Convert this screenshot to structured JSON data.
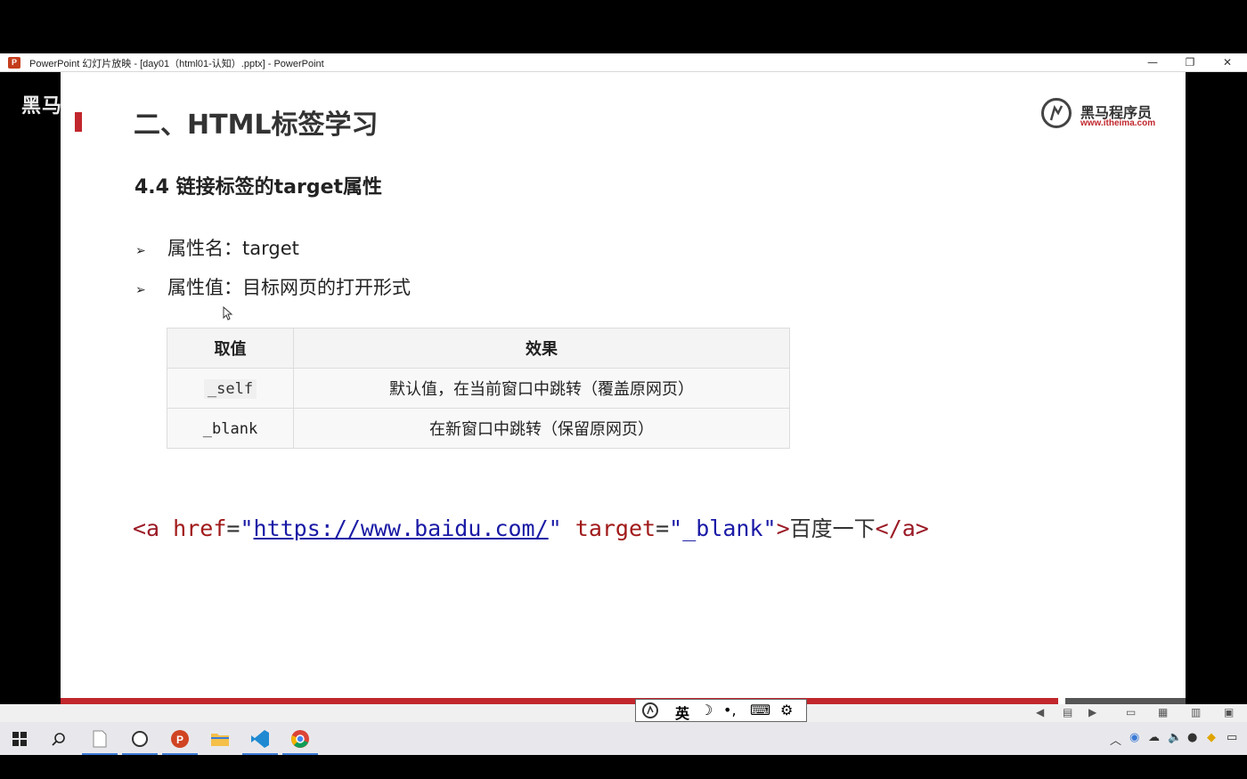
{
  "window": {
    "title": "PowerPoint 幻灯片放映 - [day01（html01-认知）.pptx] - PowerPoint",
    "minimize": "—",
    "restore": "❐",
    "close": "✕"
  },
  "watermark": {
    "text": "黑马"
  },
  "slide": {
    "title": "二、HTML标签学习",
    "logo": {
      "name": "黑马程序员",
      "url": "www.itheima.com"
    },
    "subheading": "4.4 链接标签的target属性",
    "bullets": [
      {
        "marker": "➢",
        "text": "属性名：target"
      },
      {
        "marker": "➢",
        "text": "属性值：目标网页的打开形式"
      }
    ],
    "table": {
      "headers": [
        "取值",
        "效果"
      ],
      "rows": [
        {
          "value": "_self",
          "effect": "默认值，在当前窗口中跳转（覆盖原网页）"
        },
        {
          "value": "_blank",
          "effect": "在新窗口中跳转（保留原网页）"
        }
      ]
    },
    "code": {
      "open": "<a",
      "href_attr": "href",
      "eq1": "=",
      "q1": "\"",
      "href_value": "https://www.baidu.com/",
      "q2": "\"",
      "target_attr": "target",
      "eq2": "=",
      "target_value": "\"_blank\"",
      "gt": ">",
      "link_text": "百度一下",
      "close": "</a>"
    }
  },
  "ime": {
    "mode": "英",
    "moon": "☽",
    "punct": "•,",
    "keyboard": "⌨",
    "settings": "⚙"
  },
  "colors": {
    "accent_red": "#c1272d",
    "code_blue": "#1a1aa6"
  }
}
